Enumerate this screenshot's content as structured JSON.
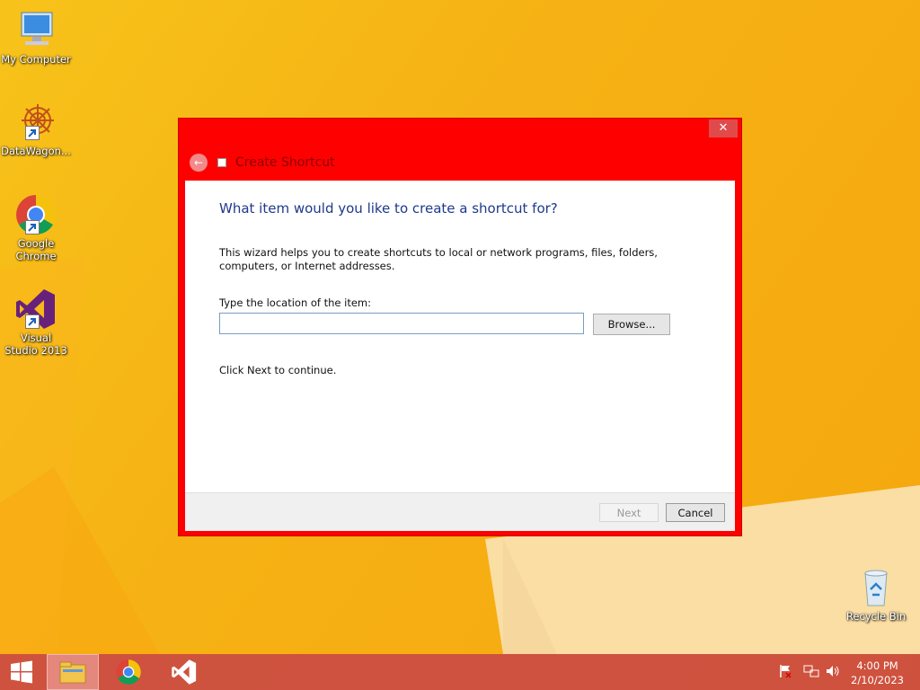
{
  "desktop": {
    "icons": [
      {
        "label": "My Computer",
        "icon": "computer-icon"
      },
      {
        "label": "DataWagon...",
        "icon": "datawagon-icon"
      },
      {
        "label": "Google Chrome",
        "icon": "chrome-icon"
      },
      {
        "label": "Visual Studio 2013",
        "icon": "visual-studio-icon"
      },
      {
        "label": "Recycle Bin",
        "icon": "recycle-bin-icon"
      }
    ]
  },
  "dialog": {
    "title": "Create Shortcut",
    "close_glyph": "✕",
    "back_glyph": "←",
    "heading": "What item would you like to create a shortcut for?",
    "description": "This wizard helps you to create shortcuts to local or network programs, files, folders, computers, or Internet addresses.",
    "location_label": "Type the location of the item:",
    "location_value": "",
    "browse_label": "Browse...",
    "continue_text": "Click Next to continue.",
    "next_label": "Next",
    "cancel_label": "Cancel",
    "colors": {
      "frame": "#ff0000",
      "heading": "#1e3a8a"
    }
  },
  "taskbar": {
    "items": [
      "start-icon",
      "file-explorer-icon",
      "chrome-icon",
      "visual-studio-icon"
    ],
    "tray": [
      "flag-icon",
      "network-icon",
      "volume-icon"
    ],
    "time": "4:00 PM",
    "date": "2/10/2023"
  }
}
